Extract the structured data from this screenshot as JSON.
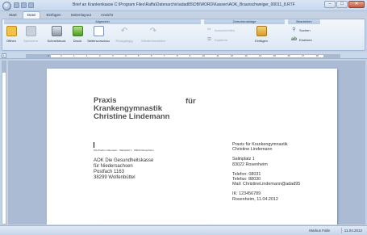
{
  "window": {
    "title": "Brief an Krankenkasse C:\\Program Files\\Raffa\\Datenarchiv\\adad85\\DB\\WORD\\Kassen\\AOK_Braunschweiger_00011_8.RTF",
    "minimize": "–",
    "maximize": "□",
    "close": "✕"
  },
  "tabs": [
    {
      "label": "Start"
    },
    {
      "label": "Datei"
    },
    {
      "label": "Einfügen"
    },
    {
      "label": "Seitenlayout"
    },
    {
      "label": "Ansicht"
    }
  ],
  "ribbon": {
    "group_allgemein": "Allgemein",
    "group_zwischenablage": "Zwischenablage",
    "group_bearbeiten": "Bearbeiten",
    "buttons": [
      {
        "label": "Öffnen",
        "icon": "open-folder-icon"
      },
      {
        "label": "Speichern",
        "icon": "save-icon"
      },
      {
        "label": "Schnelldruck",
        "icon": "quick-print-icon"
      },
      {
        "label": "Druck",
        "icon": "print-icon"
      },
      {
        "label": "Seitenvorschau",
        "icon": "page-preview-icon"
      },
      {
        "label": "Rückgängig",
        "icon": "undo-icon"
      },
      {
        "label": "Wiederherstellen",
        "icon": "redo-icon"
      }
    ],
    "ausschneiden": "Ausschneiden",
    "kopieren": "Kopieren",
    "einfuegen": "Einfügen",
    "suchen": "Suchen",
    "ersetzen": "Ersetzen"
  },
  "ruler": {
    "corner": "L",
    "marks": [
      "3",
      "2",
      "1",
      "1",
      "2",
      "3",
      "4",
      "5",
      "6",
      "7",
      "8",
      "9",
      "10",
      "11",
      "12",
      "13",
      "14",
      "15",
      "16",
      "17",
      "18"
    ]
  },
  "document": {
    "praxis_lines": [
      "Praxis",
      "Krankengymnastik",
      "Christine Lindemann"
    ],
    "fuer": "für",
    "sender_line": "KG-Praxis Lindemann · Salinplatz 1 · 83022 Rosenheim",
    "recipient": [
      "AOK Die Gesundheitskasse",
      "für Niedersachsen",
      "Postfach 1163",
      "38299 Wolfenbüttel"
    ],
    "right_block": [
      "Praxis für Krankengymnastik",
      "Christine Lindemann",
      "",
      "Salinplatz  1",
      "83022 Rosenheim",
      "",
      "Telefon: 08031",
      "Telefax: 88030",
      "Mail: ChristineLindemann@adad95",
      "",
      "IK: 123456789",
      "Rosenheim, 11.04.2012"
    ]
  },
  "status": {
    "user": "Markus Falle",
    "date": "11.04.2012"
  }
}
